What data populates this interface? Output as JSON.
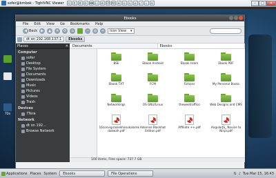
{
  "vnc": {
    "title": "sofer@bmbok - TightVNC Viewer",
    "tools": [
      "⊡",
      "⌗",
      "⚙",
      "⟳",
      "⌨",
      "☐",
      "⊞",
      "Ctl",
      "Alt",
      "⊕",
      "⊖",
      "⊙",
      "⊘",
      "⤢",
      "⌕",
      "⊟"
    ],
    "win_min": "–",
    "win_max": "□",
    "win_close": "✕"
  },
  "desktop": {
    "icons": [
      {
        "label": "",
        "color": "#5aa02c"
      },
      {
        "label": "",
        "color": "#e8e8e8"
      },
      {
        "label": "7Do",
        "color": "#2a5b8a"
      }
    ]
  },
  "fm": {
    "title": "Ebooks",
    "menu": [
      "File",
      "Edit",
      "View",
      "Go",
      "Bookmarks",
      "Help"
    ],
    "toolbar": {
      "back": "Back",
      "view_mode": "Icon View"
    },
    "location": {
      "crumbs": [
        "dt on 192.168.137.1",
        "Ebooks"
      ]
    },
    "sidebar": {
      "header": "Places",
      "sections": [
        {
          "title": "Computer",
          "items": [
            "sofer",
            "Desktop",
            "File System",
            "Documents",
            "Downloads",
            "Music",
            "Pictures",
            "Videos",
            "Trash"
          ]
        },
        {
          "title": "Devices",
          "items": [
            "7Tera"
          ]
        },
        {
          "title": "Network",
          "items": [
            "dt on 192...",
            "Browse Network"
          ]
        }
      ]
    },
    "panes": {
      "left_tab": "Documents",
      "right_tab": "Ebooks"
    },
    "items": [
      {
        "kind": "folder",
        "label": "BSE"
      },
      {
        "kind": "folder",
        "label": "Ebook Android"
      },
      {
        "kind": "folder",
        "label": "Ebook Islam"
      },
      {
        "kind": "folder",
        "label": "Ebook PDF"
      },
      {
        "kind": "folder",
        "label": "Ebook TXT"
      },
      {
        "kind": "folder",
        "label": "FCM"
      },
      {
        "kind": "folder",
        "label": "Fictions"
      },
      {
        "kind": "folder",
        "label": "My Personal Books"
      },
      {
        "kind": "folder",
        "label": "Networkings"
      },
      {
        "kind": "folder",
        "label": "OS GNU/Linux"
      },
      {
        "kind": "folder",
        "label": "theweetraffico"
      },
      {
        "kind": "folder",
        "label": "Web Designs and CMS"
      },
      {
        "kind": "pdf",
        "label": "16convsprasiekhanukalamk dakwah.pdf"
      },
      {
        "kind": "pdf",
        "label": "Adsense Blackhat Edition.pdf"
      },
      {
        "kind": "pdf",
        "label": "Affiliate ++.pdf"
      },
      {
        "kind": "pdf",
        "label": "AngularJS_ Novice to Ninja.pdf"
      }
    ],
    "status": "100 items, Free space: 737.7 GB"
  },
  "taskbar": {
    "menu": "Applications",
    "places": "Places",
    "system": "System",
    "windows": [
      "Ebooks",
      "File Operations"
    ],
    "clock": "Tue Mar 15, 16:43"
  }
}
